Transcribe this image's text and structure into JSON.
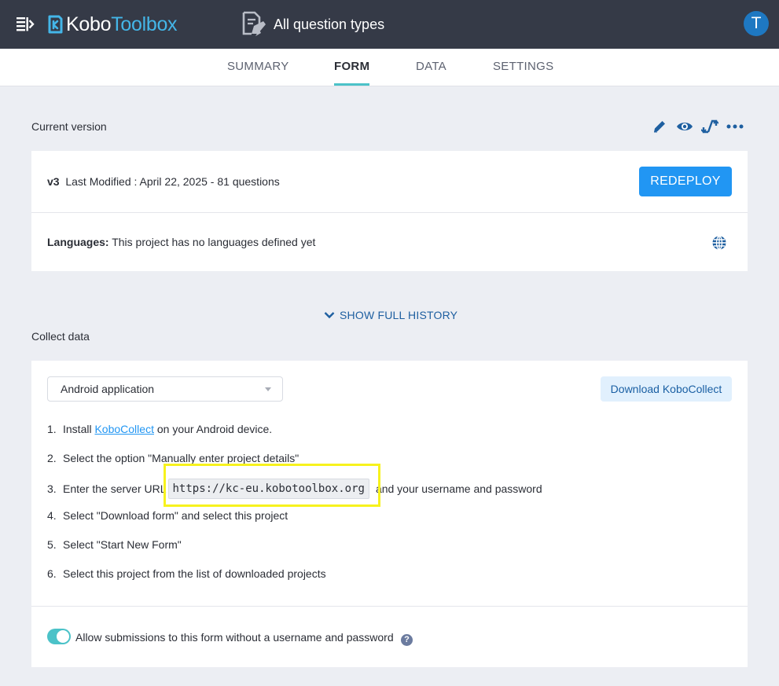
{
  "header": {
    "logo_kobo": "Kobo",
    "logo_toolbox": "Toolbox",
    "project_title": "All question types",
    "avatar_letter": "T"
  },
  "tabs": [
    {
      "label": "SUMMARY",
      "active": false
    },
    {
      "label": "FORM",
      "active": true
    },
    {
      "label": "DATA",
      "active": false
    },
    {
      "label": "SETTINGS",
      "active": false
    }
  ],
  "current_version": {
    "section_label": "Current version",
    "version": "v3",
    "modified_text": "Last Modified : April 22, 2025 - 81 questions",
    "redeploy_label": "REDEPLOY",
    "languages_label": "Languages:",
    "languages_text": "This project has no languages defined yet",
    "actions": [
      "edit-icon",
      "preview-icon",
      "replace-icon",
      "more-icon"
    ]
  },
  "history_label": "SHOW FULL HISTORY",
  "collect": {
    "section_label": "Collect data",
    "method_selected": "Android application",
    "download_label": "Download KoboCollect",
    "steps": [
      {
        "num": "1.",
        "pre": "Install ",
        "link": "KoboCollect",
        "post": " on your Android device."
      },
      {
        "num": "2.",
        "text": "Select the option \"Manually enter project details\""
      },
      {
        "num": "3.",
        "pre": "Enter the server URL",
        "url": "https://kc-eu.kobotoolbox.org",
        "post": "and your username and password"
      },
      {
        "num": "4.",
        "text": "Select \"Download form\" and select this project"
      },
      {
        "num": "5.",
        "text": "Select \"Start New Form\""
      },
      {
        "num": "6.",
        "text": "Select this project from the list of downloaded projects"
      }
    ],
    "anonymous_toggle_on": true,
    "anonymous_label": "Allow submissions to this form without a username and password",
    "help_glyph": "?"
  },
  "colors": {
    "header_bg": "#353a47",
    "accent_teal": "#4bc2c8",
    "primary_blue": "#2196f3",
    "highlight_yellow": "#f7f21d"
  }
}
